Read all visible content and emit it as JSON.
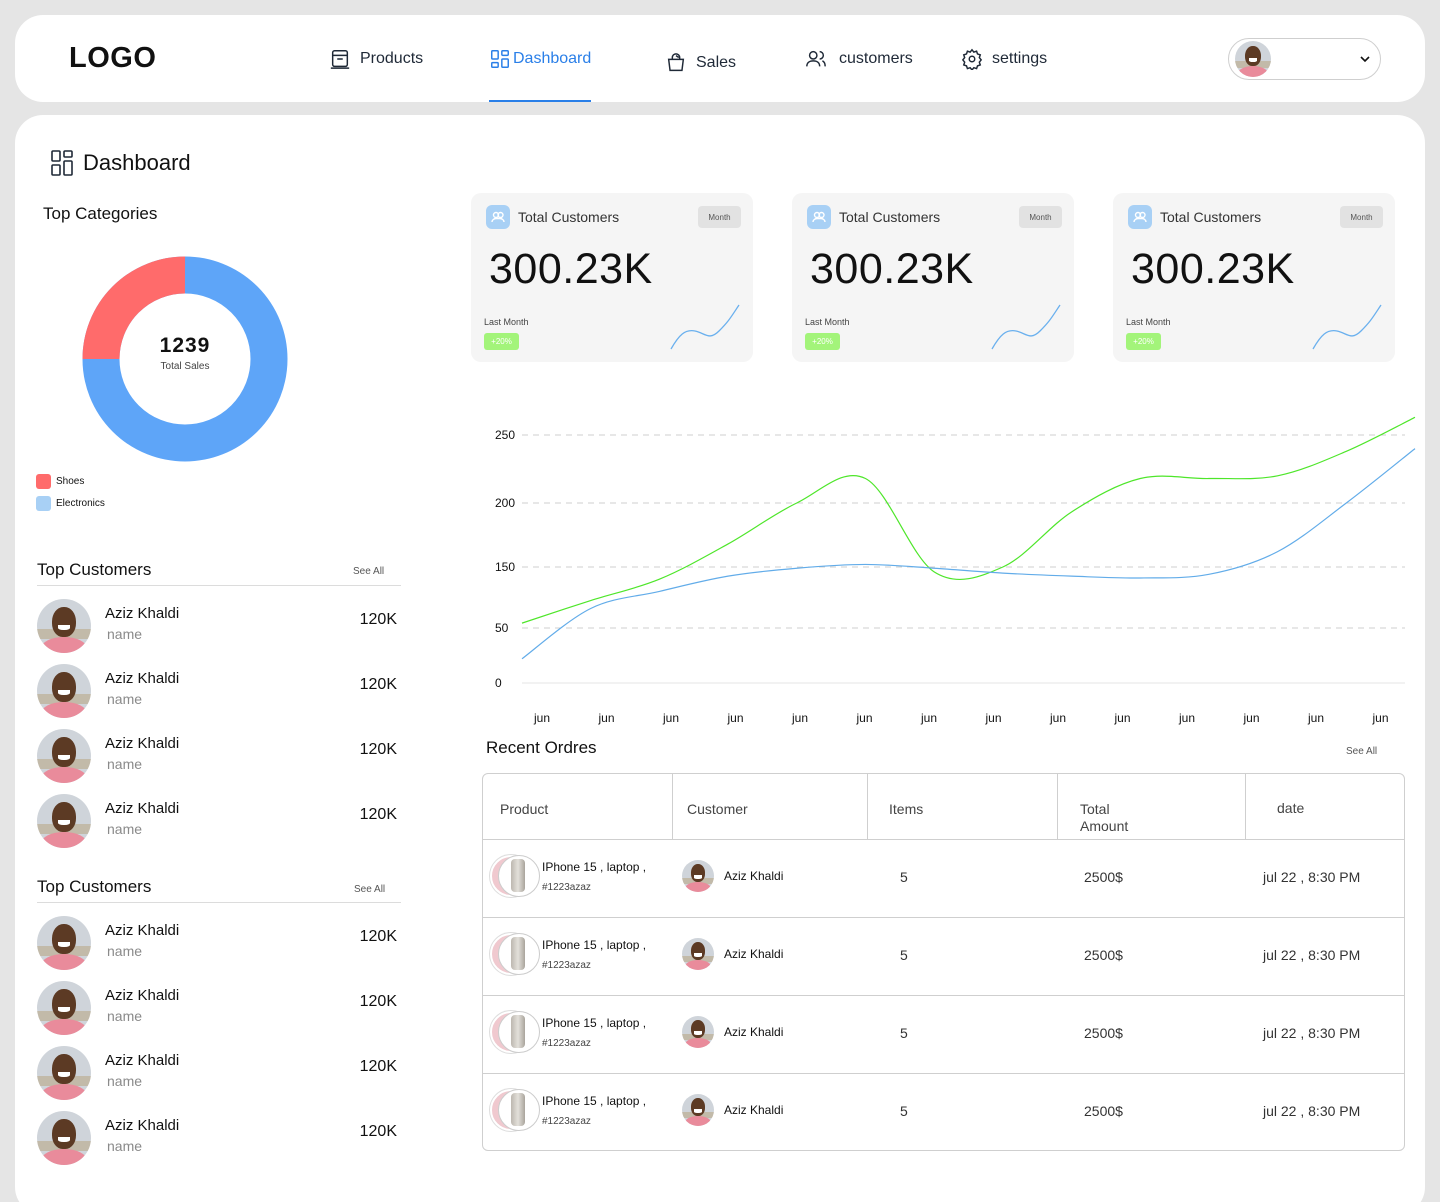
{
  "nav": {
    "logo": "LOGO",
    "items": [
      {
        "label": "Products",
        "icon": "box-icon"
      },
      {
        "label": "Dashboard",
        "icon": "grid-icon",
        "active": true
      },
      {
        "label": "Sales",
        "icon": "shopping-bag-icon"
      },
      {
        "label": "customers",
        "icon": "users-icon"
      },
      {
        "label": "settings",
        "icon": "gear-icon"
      }
    ]
  },
  "page": {
    "title": "Dashboard"
  },
  "categories": {
    "title": "Top Categories",
    "total": "1239",
    "total_label": "Total Sales",
    "legend": [
      {
        "label": "Shoes",
        "color": "#ff6b6b",
        "share": 0.25
      },
      {
        "label": "Electronics",
        "color": "#5ea5f8",
        "share": 0.75
      }
    ]
  },
  "top_customers_1": {
    "title": "Top Customers",
    "see_all": "See All",
    "rows": [
      {
        "name": "Aziz Khaldi",
        "sub": "name",
        "value": "120K"
      },
      {
        "name": "Aziz Khaldi",
        "sub": "name",
        "value": "120K"
      },
      {
        "name": "Aziz Khaldi",
        "sub": "name",
        "value": "120K"
      },
      {
        "name": "Aziz Khaldi",
        "sub": "name",
        "value": "120K"
      }
    ]
  },
  "top_customers_2": {
    "title": "Top Customers",
    "see_all": "See All",
    "rows": [
      {
        "name": "Aziz Khaldi",
        "sub": "name",
        "value": "120K"
      },
      {
        "name": "Aziz Khaldi",
        "sub": "name",
        "value": "120K"
      },
      {
        "name": "Aziz Khaldi",
        "sub": "name",
        "value": "120K"
      },
      {
        "name": "Aziz Khaldi",
        "sub": "name",
        "value": "120K"
      }
    ]
  },
  "stats": [
    {
      "title": "Total Customers",
      "period": "Month",
      "value": "300.23K",
      "last_label": "Last Month",
      "change": "+20%"
    },
    {
      "title": "Total Customers",
      "period": "Month",
      "value": "300.23K",
      "last_label": "Last Month",
      "change": "+20%"
    },
    {
      "title": "Total Customers",
      "period": "Month",
      "value": "300.23K",
      "last_label": "Last Month",
      "change": "+20%"
    }
  ],
  "chart_data": {
    "type": "line",
    "title": "",
    "xlabel": "",
    "ylabel": "",
    "categories": [
      "jun",
      "jun",
      "jun",
      "jun",
      "jun",
      "jun",
      "jun",
      "jun",
      "jun",
      "jun",
      "jun",
      "jun",
      "jun",
      "jun"
    ],
    "y_ticks": [
      "250",
      "200",
      "150",
      "50",
      "0"
    ],
    "grid": true,
    "series": [
      {
        "color": "#4ee62a",
        "values": [
          58,
          95,
          130,
          168,
          200,
          218,
          142,
          150,
          193,
          218,
          218,
          220,
          238,
          263
        ]
      },
      {
        "color": "#62ace9",
        "values": [
          22,
          82,
          110,
          135,
          148,
          152,
          148,
          140,
          135,
          132,
          138,
          162,
          200,
          240
        ]
      }
    ]
  },
  "orders": {
    "title": "Recent Ordres",
    "see_all": "See All",
    "headers": {
      "product": "Product",
      "customer": "Customer",
      "items": "Items",
      "amount_1": "Total",
      "amount_2": "Amount",
      "date": "date"
    },
    "rows": [
      {
        "product": "IPhone 15 , laptop ,",
        "id": "#1223azaz",
        "customer": "Aziz Khaldi",
        "items": "5",
        "amount": "2500$",
        "date": "jul 22 , 8:30 PM"
      },
      {
        "product": "IPhone 15 , laptop ,",
        "id": "#1223azaz",
        "customer": "Aziz Khaldi",
        "items": "5",
        "amount": "2500$",
        "date": "jul 22 , 8:30 PM"
      },
      {
        "product": "IPhone 15 , laptop ,",
        "id": "#1223azaz",
        "customer": "Aziz Khaldi",
        "items": "5",
        "amount": "2500$",
        "date": "jul 22 , 8:30 PM"
      },
      {
        "product": "IPhone 15 , laptop ,",
        "id": "#1223azaz",
        "customer": "Aziz Khaldi",
        "items": "5",
        "amount": "2500$",
        "date": "jul 22 , 8:30 PM"
      }
    ]
  }
}
